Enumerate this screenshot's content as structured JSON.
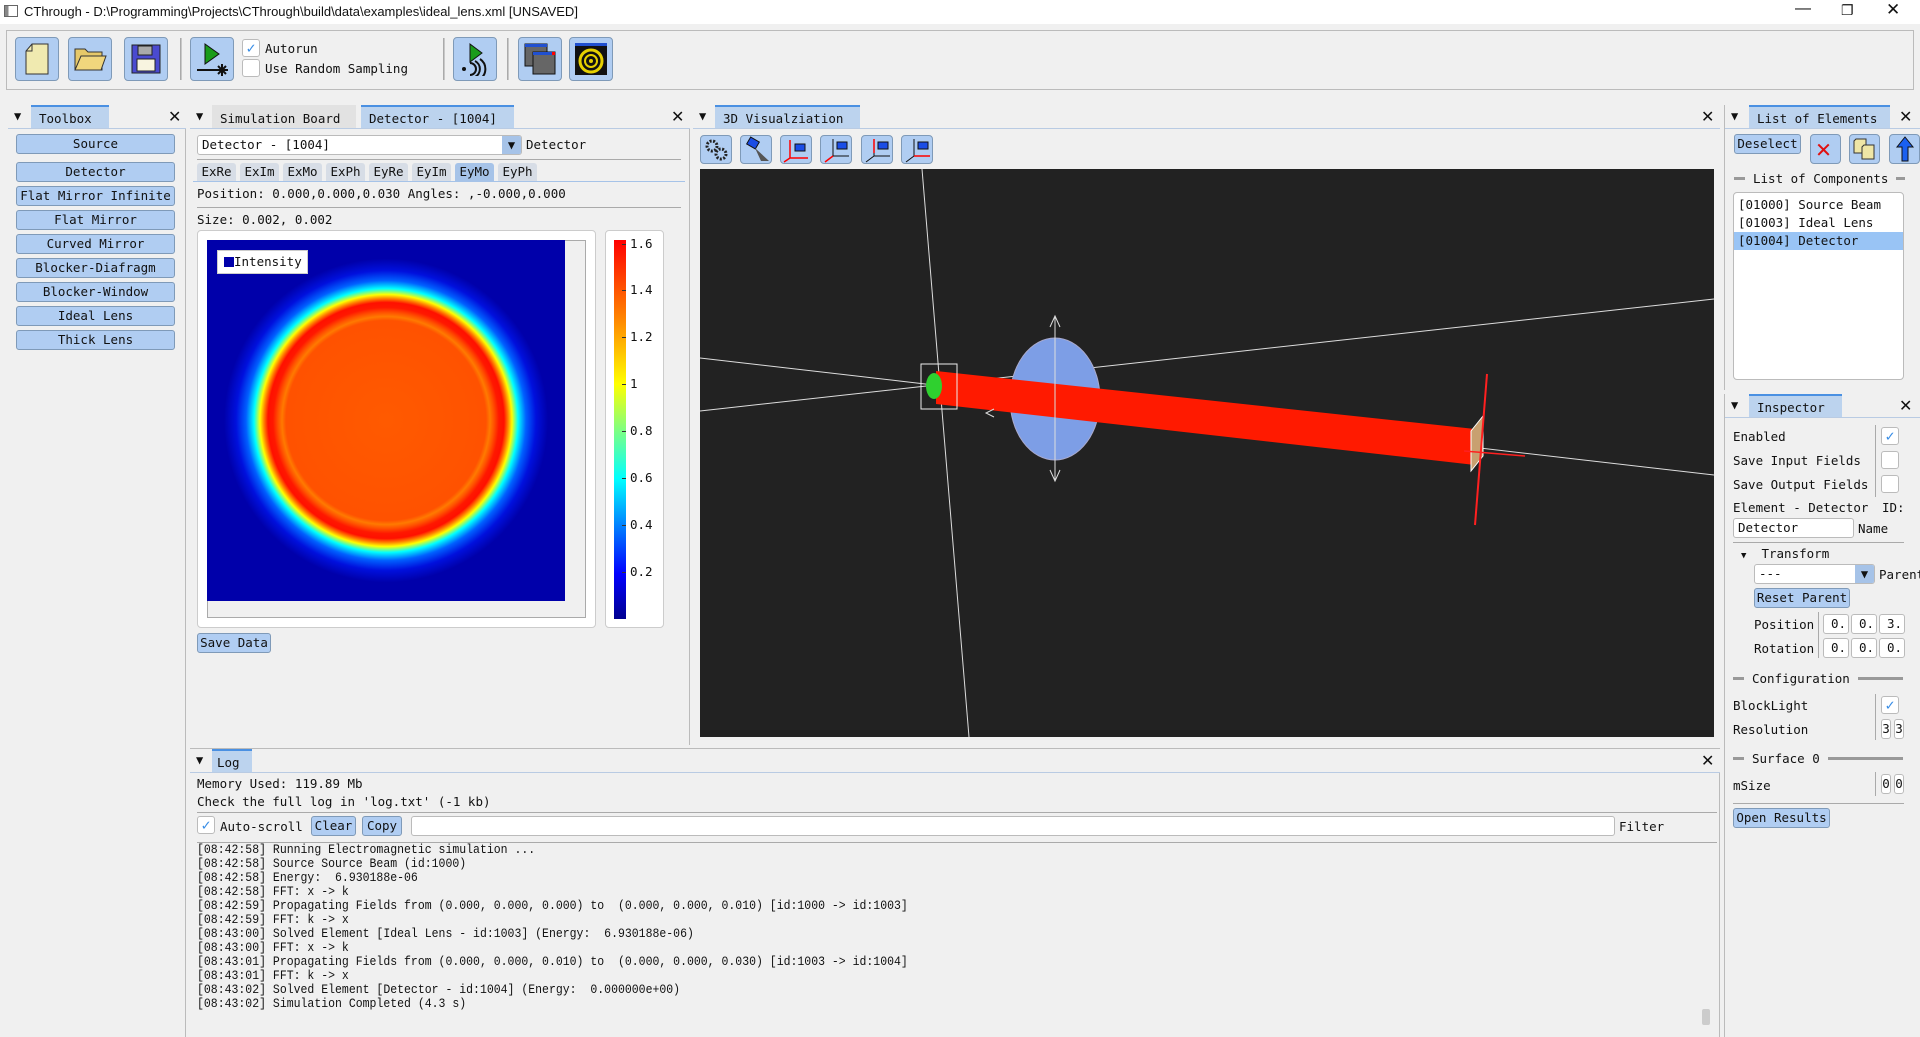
{
  "window": {
    "title": "CThrough - D:\\Programming\\Projects\\CThrough\\build\\data\\examples\\ideal_lens.xml [UNSAVED]",
    "controls": [
      "minimize",
      "restore",
      "close"
    ]
  },
  "toolbar": {
    "buttons": [
      "new-file-icon",
      "open-folder-icon",
      "save-floppy-icon",
      "run-simulation-icon",
      "run-stream-icon",
      "windows-icon",
      "target-icon"
    ],
    "autorun_label": "Autorun",
    "autorun_checked": true,
    "random_sampling_label": "Use Random Sampling",
    "random_sampling_checked": false
  },
  "toolbox": {
    "title": "Toolbox",
    "items": [
      "Source",
      "Detector",
      "Flat Mirror Infinite",
      "Flat Mirror",
      "Curved Mirror",
      "Blocker-Diafragm",
      "Blocker-Window",
      "Ideal Lens",
      "Thick Lens"
    ]
  },
  "board": {
    "tabs": [
      "Simulation Board",
      "Detector - [1004]"
    ],
    "active_tab": 1,
    "selector_value": "Detector - [1004]",
    "selector_label": "Detector",
    "field_tabs": [
      "ExRe",
      "ExIm",
      "ExMo",
      "ExPh",
      "EyRe",
      "EyIm",
      "EyMo",
      "EyPh"
    ],
    "active_field_tab": 6,
    "position_text": "Position: 0.000,0.000,0.030  Angles: ,-0.000,0.000",
    "size_text": "Size: 0.002, 0.002",
    "legend": "Intensity",
    "colorbar_ticks": [
      "1.6",
      "1.4",
      "1.2",
      "1",
      "0.8",
      "0.6",
      "0.4",
      "0.2"
    ],
    "colorbar_range": [
      0,
      1.615
    ],
    "save_button": "Save Data"
  },
  "viz": {
    "title": "3D Visualziation",
    "buttons": [
      "settings-gears-icon",
      "camera-free-icon",
      "camera-xy-icon",
      "camera-x-icon",
      "camera-y-icon",
      "camera-z-icon"
    ],
    "background": "#222222",
    "beam_color": "#ff1a00"
  },
  "elements": {
    "title": "List of Elements",
    "deselect": "Deselect",
    "list_label": "List of Components",
    "items": [
      "[01000] Source Beam",
      "[01003] Ideal Lens",
      "[01004] Detector"
    ],
    "selected": 2
  },
  "inspector": {
    "title": "Inspector",
    "enabled": "Enabled",
    "enabled_checked": true,
    "save_input": "Save Input Fields",
    "save_input_checked": false,
    "save_output": "Save Output Fields",
    "save_output_checked": false,
    "element_label": "Element - Detector",
    "id_label": "ID:",
    "name_value": "Detector",
    "name_label": "Name",
    "transform": "Transform",
    "parent_value": "---",
    "parent_label": "Parent",
    "reset_parent": "Reset Parent",
    "position_label": "Position",
    "position": [
      "0.",
      "0.",
      "3."
    ],
    "rotation_label": "Rotation",
    "rotation": [
      "0.",
      "0.",
      "0."
    ],
    "configuration": "Configuration",
    "blocklight": "BlockLight",
    "blocklight_checked": true,
    "resolution": "Resolution",
    "resolution_values": [
      "3",
      "3"
    ],
    "surface": "Surface 0",
    "msize": "mSize",
    "msize_values": [
      "0",
      "0"
    ],
    "open_results": "Open Results"
  },
  "log": {
    "title": "Log",
    "memory": "Memory Used: 119.89 Mb",
    "check": "Check the full log in 'log.txt' (-1 kb)",
    "autoscroll": "Auto-scroll",
    "autoscroll_checked": true,
    "clear": "Clear",
    "copy": "Copy",
    "filter_value": "",
    "filter_label": "Filter",
    "lines": [
      "[08:42:58] Running Electromagnetic simulation ...",
      "[08:42:58] Source Source Beam (id:1000)",
      "[08:42:58] Energy:  6.930188e-06",
      "[08:42:58] FFT: x -> k",
      "[08:42:59] Propagating Fields from (0.000, 0.000, 0.000) to  (0.000, 0.000, 0.010) [id:1000 -> id:1003]",
      "[08:42:59] FFT: k -> x",
      "[08:43:00] Solved Element [Ideal Lens - id:1003] (Energy:  6.930188e-06)",
      "[08:43:00] FFT: x -> k",
      "[08:43:01] Propagating Fields from (0.000, 0.000, 0.010) to  (0.000, 0.000, 0.030) [id:1003 -> id:1004]",
      "[08:43:01] FFT: k -> x",
      "[08:43:02] Solved Element [Detector - id:1004] (Energy:  0.000000e+00)",
      "[08:43:02] Simulation Completed (4.3 s)"
    ]
  }
}
